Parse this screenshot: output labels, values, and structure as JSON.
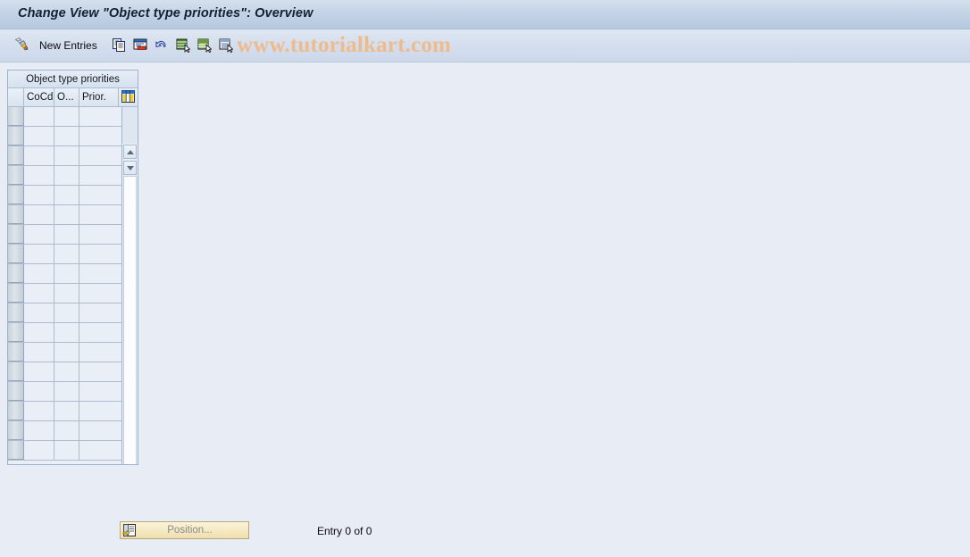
{
  "window": {
    "title": "Change View \"Object type priorities\": Overview"
  },
  "toolbar": {
    "items": [
      {
        "name": "display-change-icon",
        "label": "",
        "icon": "pencil-toggle-icon"
      },
      {
        "name": "new-entries-button",
        "label": "New Entries",
        "icon": ""
      },
      {
        "name": "copy-as-button",
        "label": "",
        "icon": "copy-icon"
      },
      {
        "name": "delete-button",
        "label": "",
        "icon": "delete-row-icon"
      },
      {
        "name": "undo-button",
        "label": "",
        "icon": "undo-arrow-icon"
      },
      {
        "name": "select-all-button",
        "label": "",
        "icon": "select-all-icon"
      },
      {
        "name": "deselect-all-button",
        "label": "",
        "icon": "deselect-all-icon"
      },
      {
        "name": "select-block-button",
        "label": "",
        "icon": "select-block-icon"
      }
    ],
    "new_entries_label": "New Entries"
  },
  "watermark": {
    "text": "www.tutorialkart.com",
    "color": "#eebb8c"
  },
  "table": {
    "caption": "Object type priorities",
    "columns": [
      {
        "key": "select",
        "label": ""
      },
      {
        "key": "cocd",
        "label": "CoCd"
      },
      {
        "key": "objtype",
        "label": "O..."
      },
      {
        "key": "prior",
        "label": "Prior."
      }
    ],
    "config_icon": "column-config-icon",
    "rows": [
      {
        "cocd": "",
        "objtype": "",
        "prior": ""
      },
      {
        "cocd": "",
        "objtype": "",
        "prior": ""
      },
      {
        "cocd": "",
        "objtype": "",
        "prior": ""
      },
      {
        "cocd": "",
        "objtype": "",
        "prior": ""
      },
      {
        "cocd": "",
        "objtype": "",
        "prior": ""
      },
      {
        "cocd": "",
        "objtype": "",
        "prior": ""
      },
      {
        "cocd": "",
        "objtype": "",
        "prior": ""
      },
      {
        "cocd": "",
        "objtype": "",
        "prior": ""
      },
      {
        "cocd": "",
        "objtype": "",
        "prior": ""
      },
      {
        "cocd": "",
        "objtype": "",
        "prior": ""
      },
      {
        "cocd": "",
        "objtype": "",
        "prior": ""
      },
      {
        "cocd": "",
        "objtype": "",
        "prior": ""
      },
      {
        "cocd": "",
        "objtype": "",
        "prior": ""
      },
      {
        "cocd": "",
        "objtype": "",
        "prior": ""
      },
      {
        "cocd": "",
        "objtype": "",
        "prior": ""
      },
      {
        "cocd": "",
        "objtype": "",
        "prior": ""
      },
      {
        "cocd": "",
        "objtype": "",
        "prior": ""
      },
      {
        "cocd": "",
        "objtype": "",
        "prior": ""
      }
    ]
  },
  "footer": {
    "position_button_label": "Position...",
    "position_button_icon": "position-icon",
    "entry_count_text": "Entry 0 of 0"
  },
  "colors": {
    "page_background": "#e8edf5",
    "title_bar": "#c2d3e6",
    "toolbar": "#d3dded",
    "grid_cell": "#e9eef7",
    "grid_line": "#aebdce",
    "button_yellow": "#f5e9c2"
  }
}
